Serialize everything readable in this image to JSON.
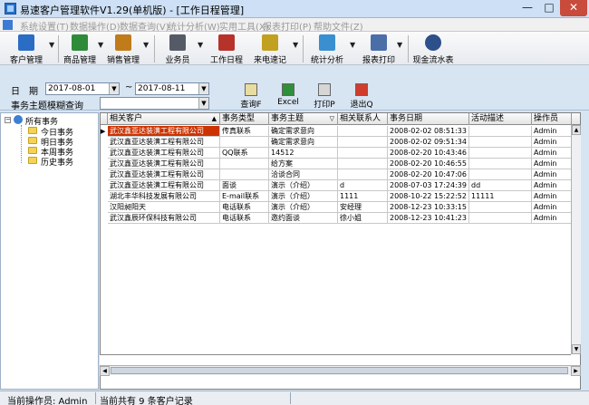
{
  "window": {
    "title": "易速客户管理软件V1.29(单机版) - [工作日程管理]",
    "min": "—",
    "max": "□",
    "close": "✕"
  },
  "menu": [
    "系统设置(T)",
    "数据操作(D)",
    "数据查询(V)",
    "统计分析(W)",
    "实用工具(X)",
    "报表打印(P)",
    "帮助文件(Z)"
  ],
  "toolbar": [
    {
      "label": "客户管理",
      "icon": "people-icon",
      "color": "#2b6cc4"
    },
    {
      "label": "商品管理",
      "icon": "box-icon",
      "color": "#2e8b3a"
    },
    {
      "label": "销售管理",
      "icon": "bag-icon",
      "color": "#c07b1b"
    },
    {
      "label": "业务员",
      "icon": "group-icon",
      "color": "#555b66"
    },
    {
      "label": "工作日程",
      "icon": "books-icon",
      "color": "#b8322c"
    },
    {
      "label": "来电速记",
      "icon": "pen-icon",
      "color": "#c2a020"
    },
    {
      "label": "统计分析",
      "icon": "chart-icon",
      "color": "#3a8fd0"
    },
    {
      "label": "报表打印",
      "icon": "printer-icon",
      "color": "#4a6fa8"
    },
    {
      "label": "现金流水表",
      "icon": "magnifier-icon",
      "color": "#2d4f8a"
    }
  ],
  "filter": {
    "date_label": "日　期",
    "date_from": "2017-08-01",
    "tilde": "~",
    "date_to": "2017-08-11",
    "fuzzy_label": "事务主题模糊查询",
    "fuzzy_value": "",
    "buttons": [
      {
        "label": "查询F",
        "icon": "query-icon",
        "color": "#e9dca0"
      },
      {
        "label": "Excel",
        "icon": "excel-icon",
        "color": "#2f8f3a"
      },
      {
        "label": "打印P",
        "icon": "print-icon",
        "color": "#d6d6d6"
      },
      {
        "label": "退出Q",
        "icon": "exit-icon",
        "color": "#d23c2c"
      }
    ]
  },
  "tree": {
    "root": "所有事务",
    "children": [
      "今日事务",
      "明日事务",
      "本周事务",
      "历史事务"
    ]
  },
  "grid": {
    "columns": [
      "相关客户",
      "事务类型",
      "事务主题",
      "相关联系人",
      "事务日期",
      "活动描述",
      "操作员"
    ],
    "sort_marks": [
      "▲",
      "",
      "▽",
      "",
      "",
      "",
      ""
    ],
    "rows": [
      [
        "武汉鑫亚达装潢工程有限公司",
        "传真联系",
        "确定需求意向",
        "",
        "2008-02-02 08:51:33",
        "",
        "Admin"
      ],
      [
        "武汉鑫亚达装潢工程有限公司",
        "",
        "确定需求意向",
        "",
        "2008-02-02 09:51:34",
        "",
        "Admin"
      ],
      [
        "武汉鑫亚达装潢工程有限公司",
        "QQ联系",
        "14512",
        "",
        "2008-02-20 10:43:46",
        "",
        "Admin"
      ],
      [
        "武汉鑫亚达装潢工程有限公司",
        "",
        "给方案",
        "",
        "2008-02-20 10:46:55",
        "",
        "Admin"
      ],
      [
        "武汉鑫亚达装潢工程有限公司",
        "",
        "洽谈合同",
        "",
        "2008-02-20 10:47:06",
        "",
        "Admin"
      ],
      [
        "武汉鑫亚达装潢工程有限公司",
        "面谈",
        "演示（介绍）",
        "d",
        "2008-07-03 17:24:39",
        "dd",
        "Admin"
      ],
      [
        "湖北丰华科技发展有限公司",
        "E-mail联系",
        "演示（介绍）",
        "1111",
        "2008-10-22 15:22:52",
        "11111",
        "Admin"
      ],
      [
        "汉阳昶阳天",
        "电话联系",
        "演示（介绍）",
        "安经理",
        "2008-12-23 10:33:15",
        "",
        "Admin"
      ],
      [
        "武汉鑫辰环保科技有限公司",
        "电话联系",
        "邀约面谈",
        "徐小姐",
        "2008-12-23 10:41:23",
        "",
        "Admin"
      ]
    ]
  },
  "status": {
    "operator": "当前操作员: Admin",
    "count": "当前共有 9 条客户记录"
  },
  "colors": {
    "selected_cell": "#cc3300",
    "window_bg": "#d7e4f2"
  }
}
